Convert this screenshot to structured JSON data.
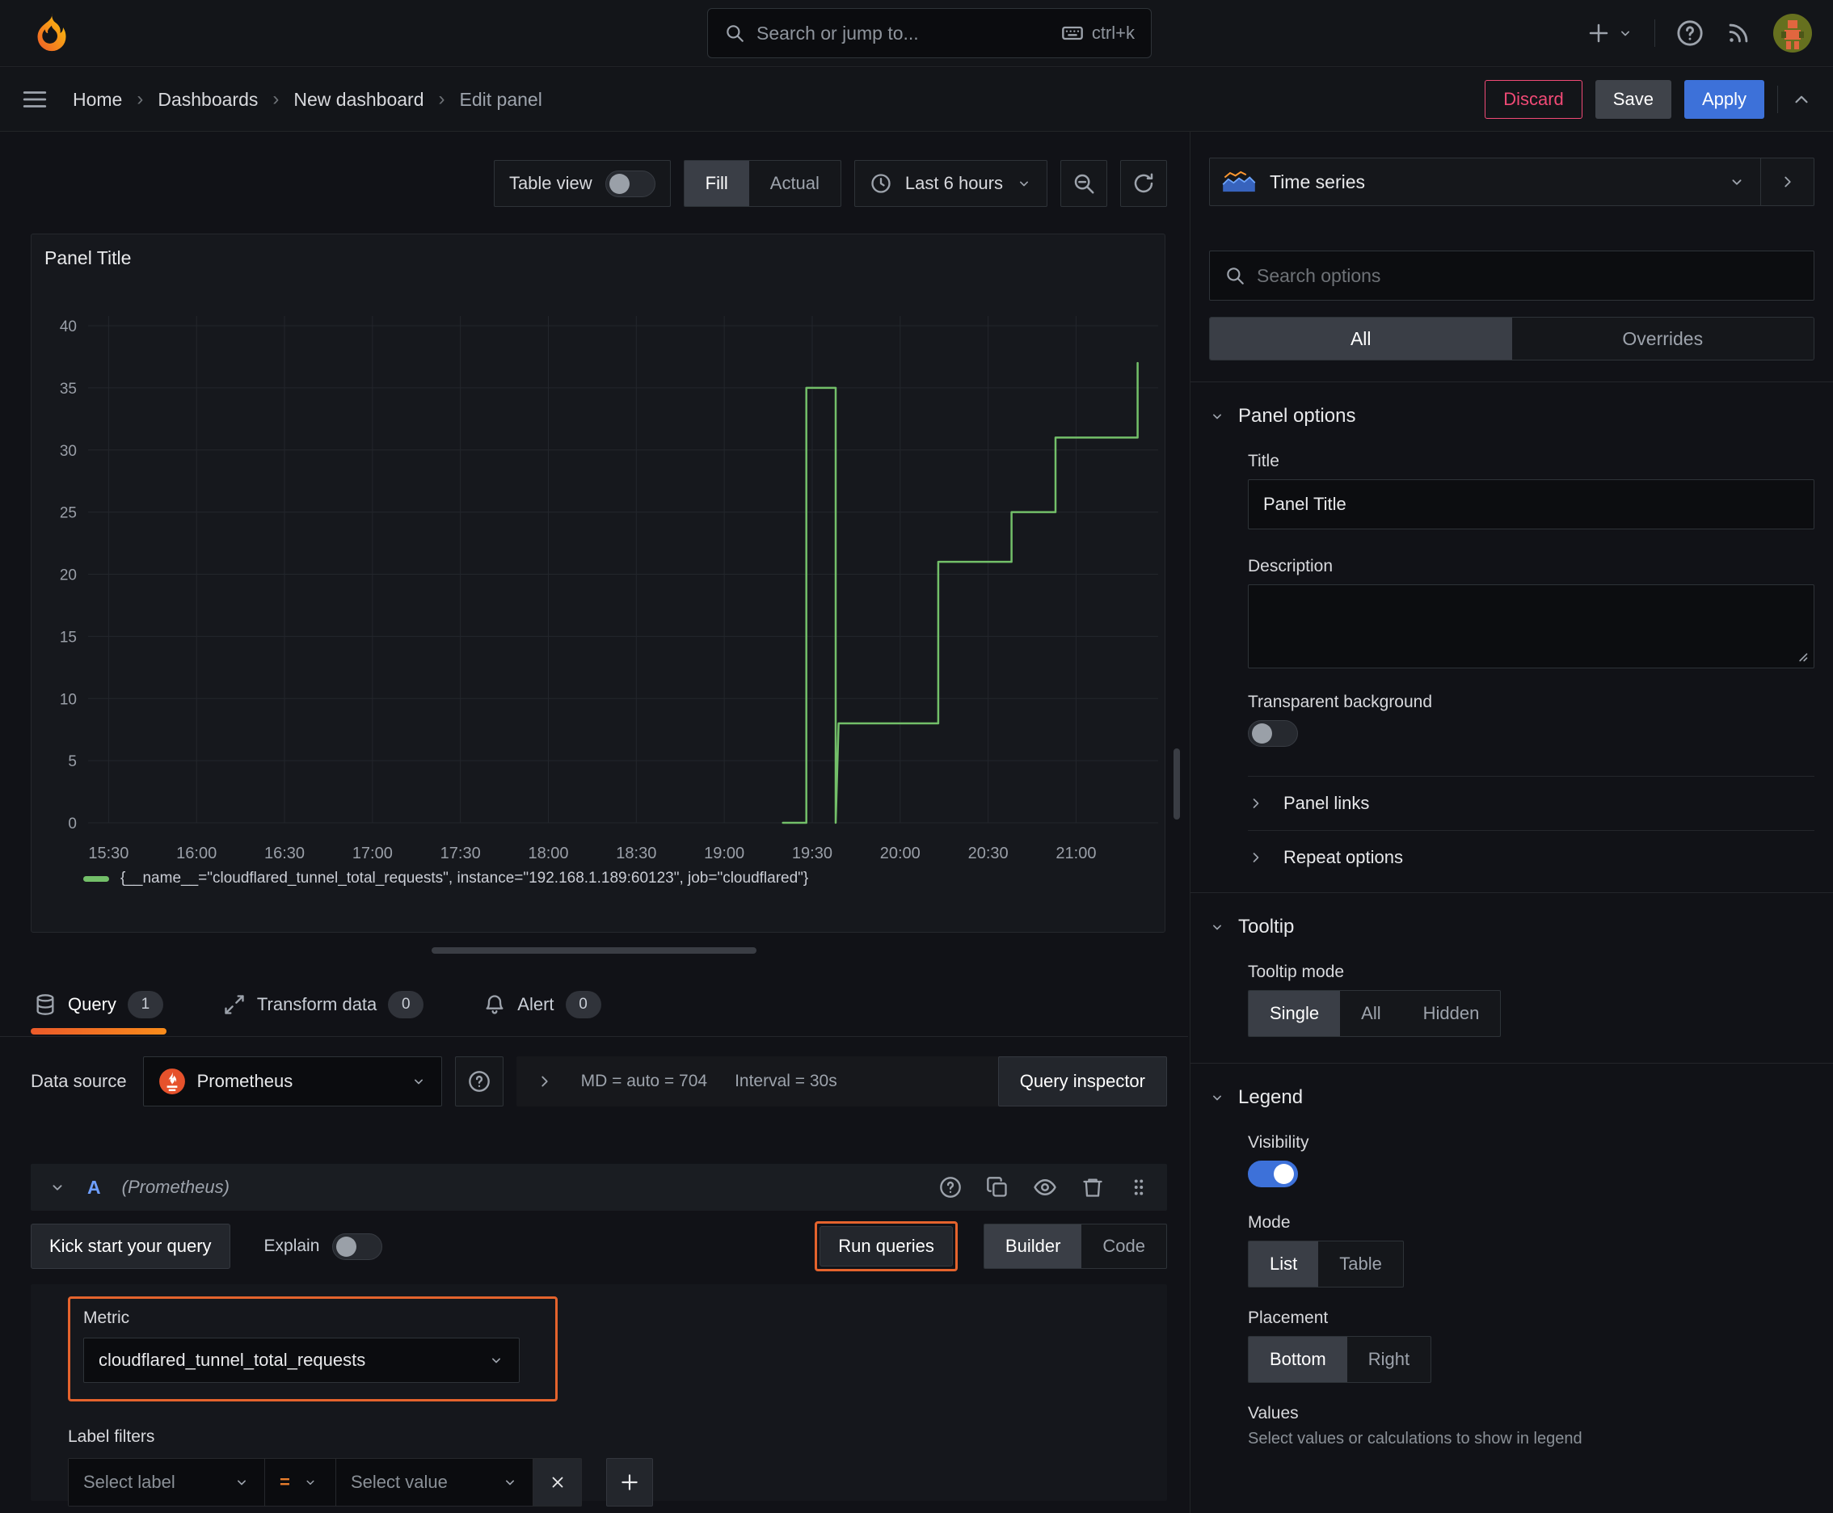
{
  "topnav": {
    "search_placeholder": "Search or jump to...",
    "shortcut": "ctrl+k"
  },
  "breadcrumb": {
    "items": [
      "Home",
      "Dashboards",
      "New dashboard",
      "Edit panel"
    ],
    "discard": "Discard",
    "save": "Save",
    "apply": "Apply"
  },
  "toolbar": {
    "table_view": "Table view",
    "fill": "Fill",
    "actual": "Actual",
    "time_range": "Last 6 hours"
  },
  "panel": {
    "title": "Panel Title"
  },
  "chart_data": {
    "type": "line",
    "line_style": "step",
    "title": "Panel Title",
    "xlabel": "",
    "ylabel": "",
    "grid": true,
    "legend_position": "bottom",
    "x_ticks": [
      "15:30",
      "16:00",
      "16:30",
      "17:00",
      "17:30",
      "18:00",
      "18:30",
      "19:00",
      "19:30",
      "20:00",
      "20:30",
      "21:00"
    ],
    "y_ticks": [
      0,
      5,
      10,
      15,
      20,
      25,
      30,
      35,
      40
    ],
    "ylim": [
      0,
      40
    ],
    "xlim_minutes": [
      -7,
      358
    ],
    "series": [
      {
        "name": "{__name__=\"cloudflared_tunnel_total_requests\", instance=\"192.168.1.189:60123\", job=\"cloudflared\"}",
        "color": "#73bf69",
        "points_minutes_from_1530": [
          [
            230,
            0
          ],
          [
            238,
            0
          ],
          [
            238,
            35
          ],
          [
            248,
            35
          ],
          [
            248,
            0
          ],
          [
            249,
            8
          ],
          [
            283,
            8
          ],
          [
            283,
            21
          ],
          [
            308,
            21
          ],
          [
            308,
            25
          ],
          [
            323,
            25
          ],
          [
            323,
            31
          ],
          [
            351,
            31
          ],
          [
            351,
            37
          ]
        ]
      }
    ]
  },
  "tabs": {
    "query": "Query",
    "query_count": "1",
    "transform": "Transform data",
    "transform_count": "0",
    "alert": "Alert",
    "alert_count": "0"
  },
  "datasource": {
    "label": "Data source",
    "name": "Prometheus",
    "md": "MD = auto = 704",
    "interval": "Interval = 30s",
    "inspector": "Query inspector"
  },
  "query_row": {
    "ref": "A",
    "ds": "(Prometheus)"
  },
  "query_actions": {
    "kickstart": "Kick start your query",
    "explain": "Explain",
    "run": "Run queries",
    "builder": "Builder",
    "code": "Code"
  },
  "builder": {
    "metric_label": "Metric",
    "metric_value": "cloudflared_tunnel_total_requests",
    "label_filters": "Label filters",
    "select_label": "Select label",
    "eq": "=",
    "select_value": "Select value"
  },
  "sidebar": {
    "viz": "Time series",
    "search_placeholder": "Search options",
    "all_tab": "All",
    "overrides_tab": "Overrides",
    "panel_options": "Panel options",
    "title_label": "Title",
    "title_value": "Panel Title",
    "description_label": "Description",
    "transparent": "Transparent background",
    "panel_links": "Panel links",
    "repeat_options": "Repeat options",
    "tooltip": "Tooltip",
    "tooltip_mode": "Tooltip mode",
    "single": "Single",
    "all2": "All",
    "hidden": "Hidden",
    "legend": "Legend",
    "visibility": "Visibility",
    "mode": "Mode",
    "list": "List",
    "table": "Table",
    "placement": "Placement",
    "bottom": "Bottom",
    "right": "Right",
    "values_label": "Values",
    "values_help": "Select values or calculations to show in legend"
  },
  "colors": {
    "accent_blue": "#3d71d9",
    "highlight_orange": "#e4632d",
    "series_green": "#73bf69",
    "discard_pink": "#f14a76"
  }
}
